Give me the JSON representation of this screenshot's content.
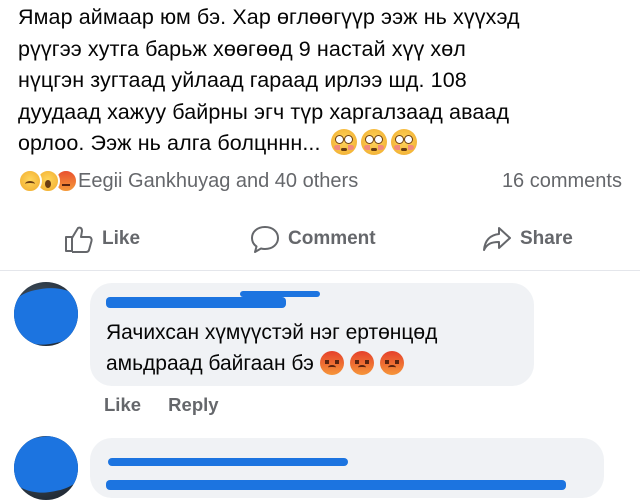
{
  "post": {
    "lines": [
      "Ямар аймаар юм бэ. Хар өглөөгүүр ээж нь хүүхэд",
      "рүүгээ хутга барьж хөөгөөд 9 настай хүү хөл",
      "нүцгэн зугтаад уйлаад гараад ирлээ шд. 108",
      "дуудаад хажуу байрны эгч түр харгалзаад аваад",
      "орлоо. Ээж нь алга болцннн..."
    ],
    "trailing_emojis": [
      "flushed-face",
      "flushed-face",
      "flushed-face"
    ]
  },
  "reactions": {
    "icons": [
      "sad-reaction",
      "wow-reaction",
      "angry-reaction"
    ],
    "names": "Eegii Gankhuyag and 40 others",
    "comments_count": "16 comments"
  },
  "actions": {
    "like": "Like",
    "comment": "Comment",
    "share": "Share"
  },
  "comments": [
    {
      "author_redacted": true,
      "text_line1": "Яачихсан хүмүүстэй нэг ертөнцөд",
      "text_line2": "амьдраад байгаан бэ",
      "emojis": [
        "angry-face",
        "angry-face",
        "angry-face"
      ],
      "like_label": "Like",
      "reply_label": "Reply"
    },
    {
      "author_redacted": true
    }
  ],
  "colors": {
    "text": "#050505",
    "secondary": "#65676b",
    "bubble": "#f0f2f5",
    "redaction": "#1c74e0"
  }
}
